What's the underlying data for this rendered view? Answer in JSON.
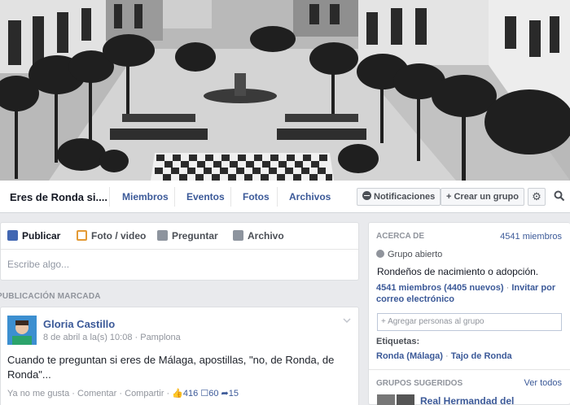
{
  "group": {
    "name": "Eres de Ronda si....",
    "tabs": [
      "Miembros",
      "Eventos",
      "Fotos",
      "Archivos"
    ],
    "notifications_label": "Notificaciones",
    "create_group_label": "+ Crear un grupo"
  },
  "composer": {
    "tabs": [
      "Publicar",
      "Foto / video",
      "Preguntar",
      "Archivo"
    ],
    "placeholder": "Escribe algo..."
  },
  "pinned_label": "PUBLICACIÓN MARCADA",
  "post": {
    "author": "Gloria Castillo",
    "meta": "8 de abril a la(s) 10:08 · Pamplona",
    "text": "Cuando te preguntan si eres de Málaga, apostillas, \"no, de Ronda, de Ronda\"...",
    "unlike": "Ya no me gusta",
    "comment": "Comentar",
    "share": "Compartir",
    "likes": "416",
    "comments": "60",
    "shares": "15"
  },
  "about": {
    "header": "ACERCA DE",
    "members_count": "4541 miembros",
    "privacy": "Grupo abierto",
    "description": "Rondeños de nacimiento o adopción.",
    "members_stat": "4541 miembros (4405 nuevos)",
    "invite_label": "Invitar por correo electrónico",
    "add_people_placeholder": "+ Agregar personas al grupo",
    "tags_label": "Etiquetas:",
    "tags": [
      "Ronda (Málaga)",
      "Tajo de Ronda"
    ],
    "suggested_header": "GRUPOS SUGERIDOS",
    "see_all": "Ver todos",
    "suggested_group": "Real Hermandad del"
  },
  "colors": {
    "link": "#3b5998",
    "background": "#e9eaed",
    "secondary_text": "#90949c"
  }
}
